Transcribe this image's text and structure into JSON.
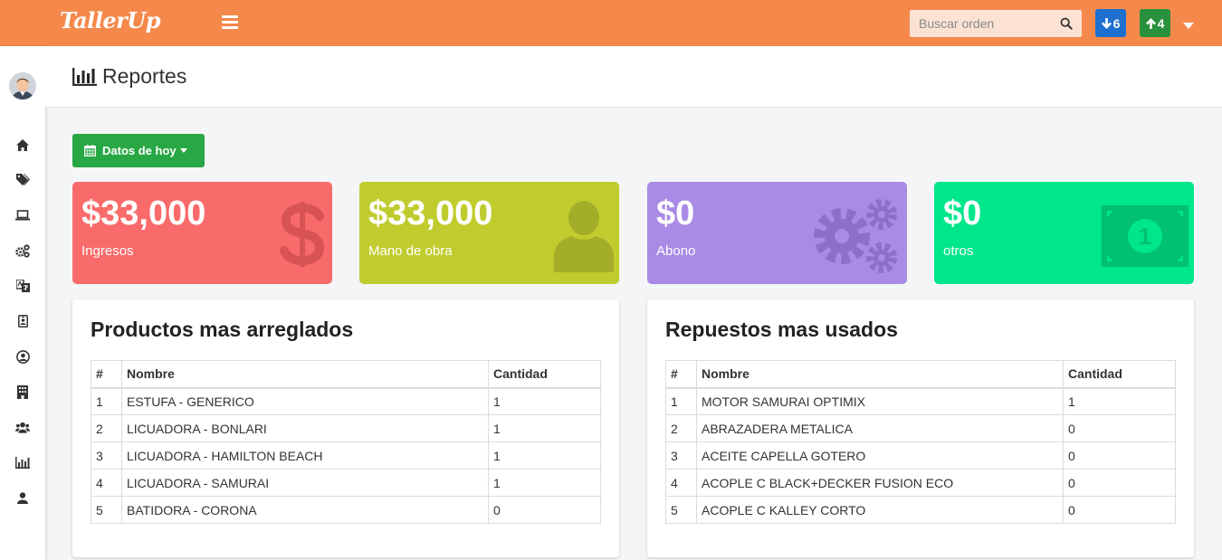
{
  "app": {
    "logo": "TallerUp"
  },
  "topbar": {
    "search_placeholder": "Buscar orden",
    "down_count": "6",
    "up_count": "4"
  },
  "sidebar": {
    "items": [
      {
        "icon": "home-icon"
      },
      {
        "icon": "tags-icon"
      },
      {
        "icon": "laptop-icon"
      },
      {
        "icon": "cogs-icon"
      },
      {
        "icon": "translate-icon"
      },
      {
        "icon": "id-badge-icon"
      },
      {
        "icon": "user-circle-icon"
      },
      {
        "icon": "building-icon"
      },
      {
        "icon": "users-icon"
      },
      {
        "icon": "bar-chart-icon"
      },
      {
        "icon": "user-icon"
      }
    ]
  },
  "header": {
    "title": "Reportes"
  },
  "filter": {
    "label": "Datos de hoy"
  },
  "stats": [
    {
      "value": "$33,000",
      "label": "Ingresos",
      "color": "#f96b6b",
      "icon": "dollar-icon"
    },
    {
      "value": "$33,000",
      "label": "Mano de obra",
      "color": "#c0cc2e",
      "icon": "user-icon"
    },
    {
      "value": "$0",
      "label": "Abono",
      "color": "#a98ae5",
      "icon": "cogs-icon"
    },
    {
      "value": "$0",
      "label": "otros",
      "color": "#00e68a",
      "icon": "money-bill-icon"
    }
  ],
  "productos": {
    "title": "Productos mas arreglados",
    "headers": [
      "#",
      "Nombre",
      "Cantidad"
    ],
    "rows": [
      [
        "1",
        "ESTUFA - GENERICO",
        "1"
      ],
      [
        "2",
        "LICUADORA - BONLARI",
        "1"
      ],
      [
        "3",
        "LICUADORA - HAMILTON BEACH",
        "1"
      ],
      [
        "4",
        "LICUADORA - SAMURAI",
        "1"
      ],
      [
        "5",
        "BATIDORA - CORONA",
        "0"
      ]
    ]
  },
  "repuestos": {
    "title": "Repuestos mas usados",
    "headers": [
      "#",
      "Nombre",
      "Cantidad"
    ],
    "rows": [
      [
        "1",
        "MOTOR SAMURAI OPTIMIX",
        "1"
      ],
      [
        "2",
        "ABRAZADERA METALICA",
        "0"
      ],
      [
        "3",
        "ACEITE CAPELLA GOTERO",
        "0"
      ],
      [
        "4",
        "ACOPLE C BLACK+DECKER FUSION ECO",
        "0"
      ],
      [
        "5",
        "ACOPLE C KALLEY CORTO",
        "0"
      ]
    ]
  }
}
